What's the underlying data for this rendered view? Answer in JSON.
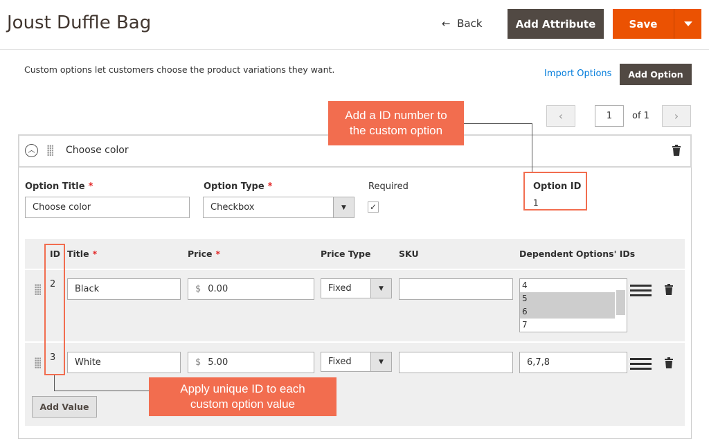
{
  "header": {
    "title": "Joust Duffle Bag",
    "back": "Back",
    "add_attribute": "Add Attribute",
    "save": "Save"
  },
  "intro": {
    "text": "Custom options let customers choose the product variations they want.",
    "import_options": "Import Options",
    "add_option": "Add Option"
  },
  "pagination": {
    "page": "1",
    "of": "of 1"
  },
  "callouts": {
    "option_id": "Add a ID number to the custom option",
    "value_id": "Apply unique ID to each custom option value"
  },
  "option": {
    "header_title": "Choose color",
    "title_label": "Option Title",
    "title_value": "Choose color",
    "type_label": "Option Type",
    "type_value": "Checkbox",
    "required_label": "Required",
    "required_checked": true,
    "id_label": "Option ID",
    "id_value": "1"
  },
  "table": {
    "headers": {
      "id": "ID",
      "title": "Title",
      "price": "Price",
      "price_type": "Price Type",
      "sku": "SKU",
      "dependent": "Dependent Options' IDs"
    },
    "rows": [
      {
        "id": "2",
        "title": "Black",
        "currency": "$",
        "price": "0.00",
        "price_type": "Fixed",
        "sku": "",
        "dependent_options": [
          "4",
          "5",
          "6",
          "7"
        ],
        "dependent_selected": [
          "5",
          "6"
        ]
      },
      {
        "id": "3",
        "title": "White",
        "currency": "$",
        "price": "5.00",
        "price_type": "Fixed",
        "sku": "",
        "dependent_value": "6,7,8"
      }
    ],
    "add_value": "Add Value"
  },
  "colors": {
    "accent": "#eb5202",
    "dark_button": "#514943",
    "callout": "#f26d4f",
    "link": "#007bdb"
  }
}
